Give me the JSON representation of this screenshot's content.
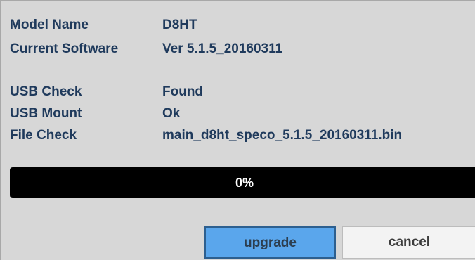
{
  "info": {
    "model_name_label": "Model Name",
    "model_name_value": "D8HT",
    "current_software_label": "Current Software",
    "current_software_value": "Ver 5.1.5_20160311",
    "usb_check_label": "USB Check",
    "usb_check_value": "Found",
    "usb_mount_label": "USB Mount",
    "usb_mount_value": "Ok",
    "file_check_label": "File Check",
    "file_check_value": "main_d8ht_speco_5.1.5_20160311.bin"
  },
  "progress": {
    "percent": 0,
    "text": "0%"
  },
  "buttons": {
    "upgrade_label": "upgrade",
    "cancel_label": "cancel"
  },
  "colors": {
    "label_text": "#1f3a5c",
    "background": "#d7d7d7",
    "progress_track": "#000000",
    "upgrade_button": "#5aa6ec",
    "cancel_button": "#f3f3f3"
  }
}
